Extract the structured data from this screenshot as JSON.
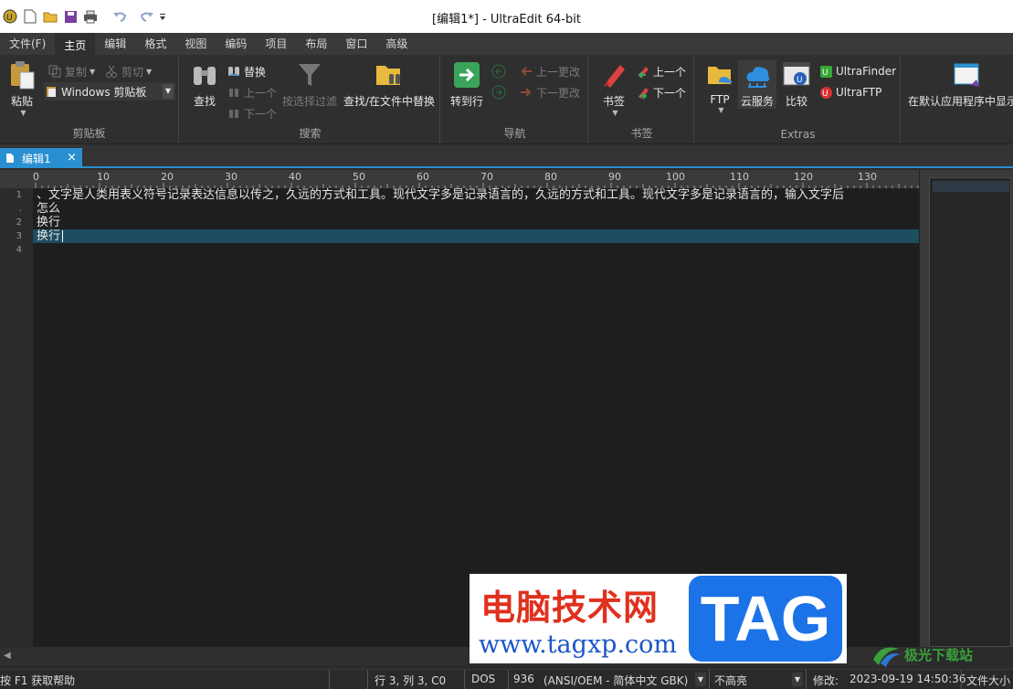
{
  "window": {
    "title": "[编辑1*] - UltraEdit 64-bit"
  },
  "menu": {
    "tabs": [
      "文件(F)",
      "主页",
      "编辑",
      "格式",
      "视图",
      "编码",
      "项目",
      "布局",
      "窗口",
      "高级"
    ],
    "active": "主页"
  },
  "ribbon": {
    "clipboard": {
      "label": "剪贴板",
      "paste": "粘贴",
      "copy": "复制",
      "cut": "剪切",
      "windows_clipboard": "Windows 剪贴板"
    },
    "search": {
      "label": "搜索",
      "find": "查找",
      "replace": "替换",
      "prev": "上一个",
      "next": "下一个",
      "filter": "按选择过滤",
      "find_in_files": "查找/在文件中替换"
    },
    "navigation": {
      "label": "导航",
      "goto": "转到行",
      "prev_change": "上一更改",
      "next_change": "下一更改"
    },
    "bookmarks": {
      "label": "书签",
      "bookmark": "书签",
      "prev": "上一个",
      "next": "下一个"
    },
    "extras": {
      "label": "Extras",
      "ftp": "FTP",
      "cloud": "云服务",
      "compare": "比较",
      "ultrafinder": "UltraFinder",
      "ultraftp": "UltraFTP"
    },
    "default_app": {
      "label": "在默认应用程序中显示"
    }
  },
  "doc_tab": {
    "label": "编辑1",
    "close": "×"
  },
  "ruler": {
    "labels": [
      "0",
      "10",
      "20",
      "30",
      "40",
      "50",
      "60",
      "70",
      "80",
      "90",
      "100",
      "110",
      "120",
      "130"
    ]
  },
  "editor": {
    "lines": [
      {
        "number": "1",
        "text": "、文字是人类用表义符号记录表达信息以传之，久远的方式和工具。现代文字多是记录语言的，久远的方式和工具。现代文字多是记录语言的，输入文字后"
      },
      {
        "number": ".",
        "text": "怎么"
      },
      {
        "number": "2",
        "text": "换行"
      },
      {
        "number": "3",
        "text": "换行"
      },
      {
        "number": "4",
        "text": ""
      }
    ],
    "current_line": 3
  },
  "status": {
    "help": "按 F1 获取帮助",
    "position": "行 3, 列 3, C0",
    "line_ending": "DOS",
    "codepage": "936",
    "encoding": "(ANSI/OEM - 简体中文 GBK)",
    "highlight": "不高亮",
    "modified_label": "修改:",
    "modified": "2023-09-19 14:50:36",
    "filesize": "文件大小"
  },
  "watermark": {
    "cn": "电脑技术网",
    "url": "www.tagxp.com",
    "tag": "TAG",
    "site2": "极光下载站"
  },
  "colors": {
    "accent": "#2a8fd0",
    "editor_bg": "#1e1e1e",
    "current_line": "#1d4d5f",
    "ribbon_bg": "#2f2f2f"
  }
}
